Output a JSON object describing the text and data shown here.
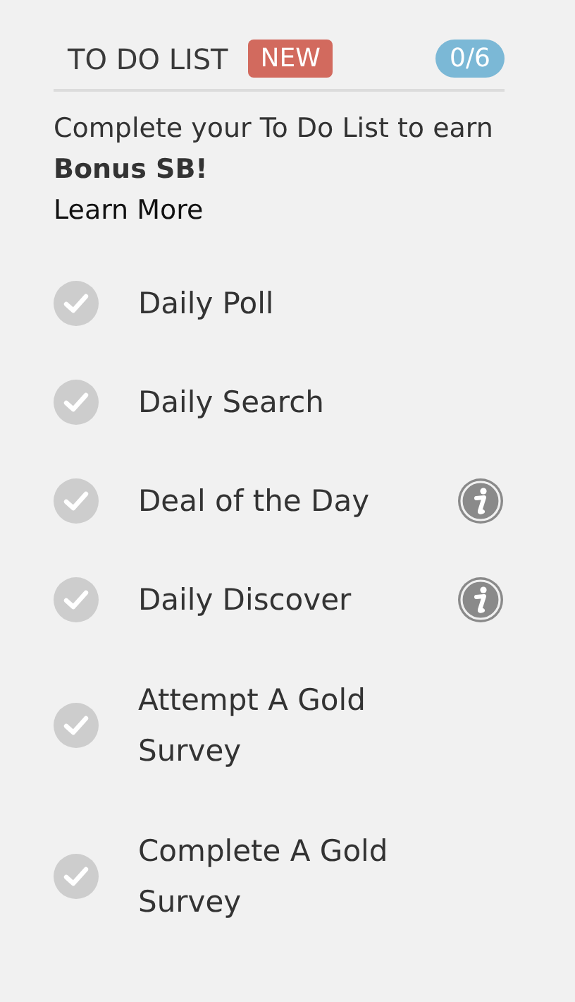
{
  "header": {
    "title": "TO DO LIST",
    "badge": "NEW",
    "progress": "0/6"
  },
  "intro": "Complete your To Do List to earn **Bonus SB!**",
  "learn_more": "Learn More",
  "tasks": [
    {
      "label": "Daily Poll",
      "done": false,
      "info": false
    },
    {
      "label": "Daily Search",
      "done": false,
      "info": false
    },
    {
      "label": "Deal of the Day",
      "done": false,
      "info": true
    },
    {
      "label": "Daily Discover",
      "done": false,
      "info": true
    },
    {
      "label": "Attempt A Gold Survey",
      "done": false,
      "info": false
    },
    {
      "label": "Complete A Gold Survey",
      "done": false,
      "info": false
    }
  ]
}
